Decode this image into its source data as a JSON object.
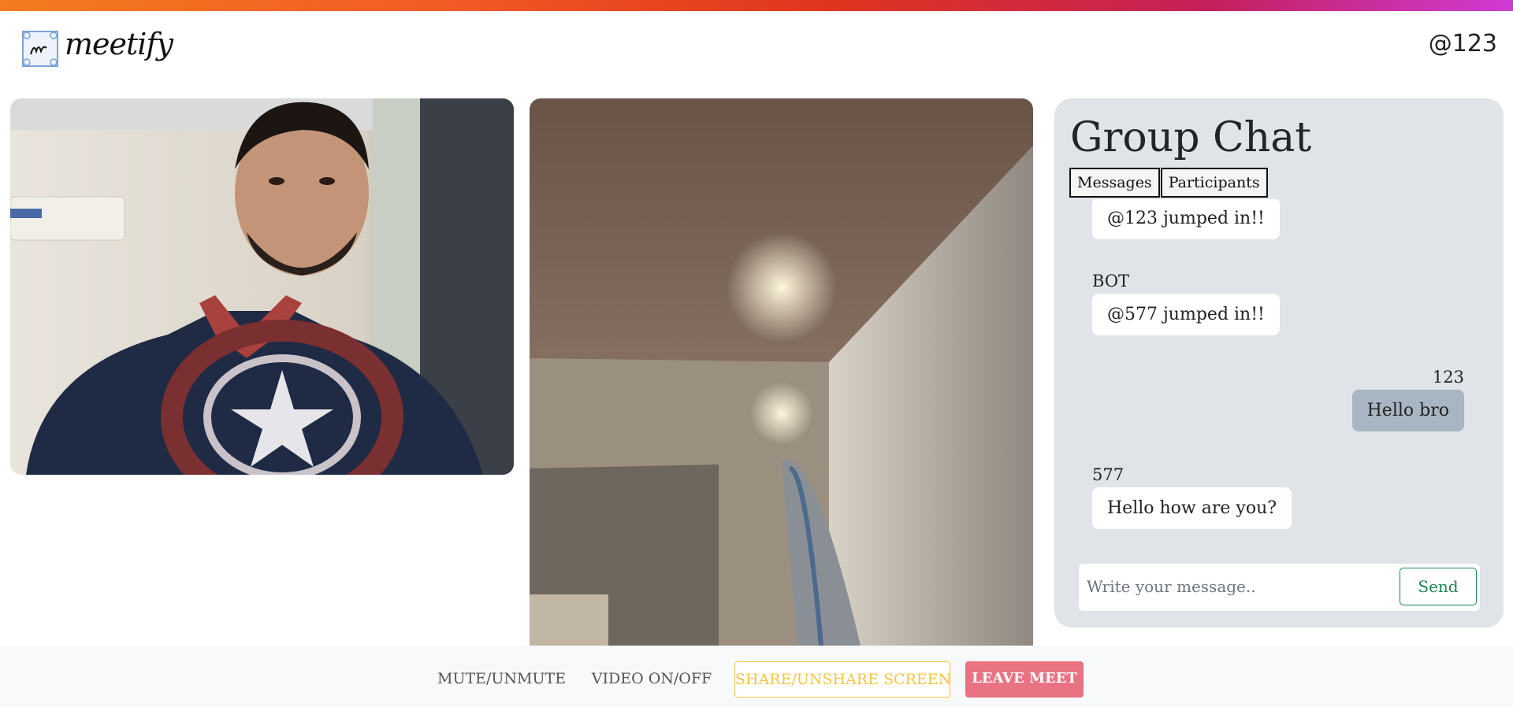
{
  "header": {
    "logo_text": "meetify",
    "user_handle": "@123"
  },
  "chat": {
    "title": "Group Chat",
    "tabs": [
      {
        "label": "Messages"
      },
      {
        "label": "Participants"
      }
    ],
    "messages": [
      {
        "sender": "",
        "text": "@123 jumped in!!",
        "mine": false
      },
      {
        "sender": "BOT",
        "text": "@577 jumped in!!",
        "mine": false
      },
      {
        "sender": "123",
        "text": "Hello bro",
        "mine": true
      },
      {
        "sender": "577",
        "text": "Hello how are you?",
        "mine": false
      }
    ],
    "composer": {
      "placeholder": "Write your message..",
      "value": "",
      "send_label": "Send"
    }
  },
  "controls": {
    "mute_label": "MUTE/UNMUTE",
    "video_label": "VIDEO ON/OFF",
    "share_label": "SHARE/UNSHARE SCREEN",
    "leave_label": "LEAVE MEET"
  },
  "colors": {
    "accent_send": "#198754",
    "share_yellow": "#f5c542",
    "leave_red": "#e97383",
    "my_bubble": "#a7b6c2"
  }
}
